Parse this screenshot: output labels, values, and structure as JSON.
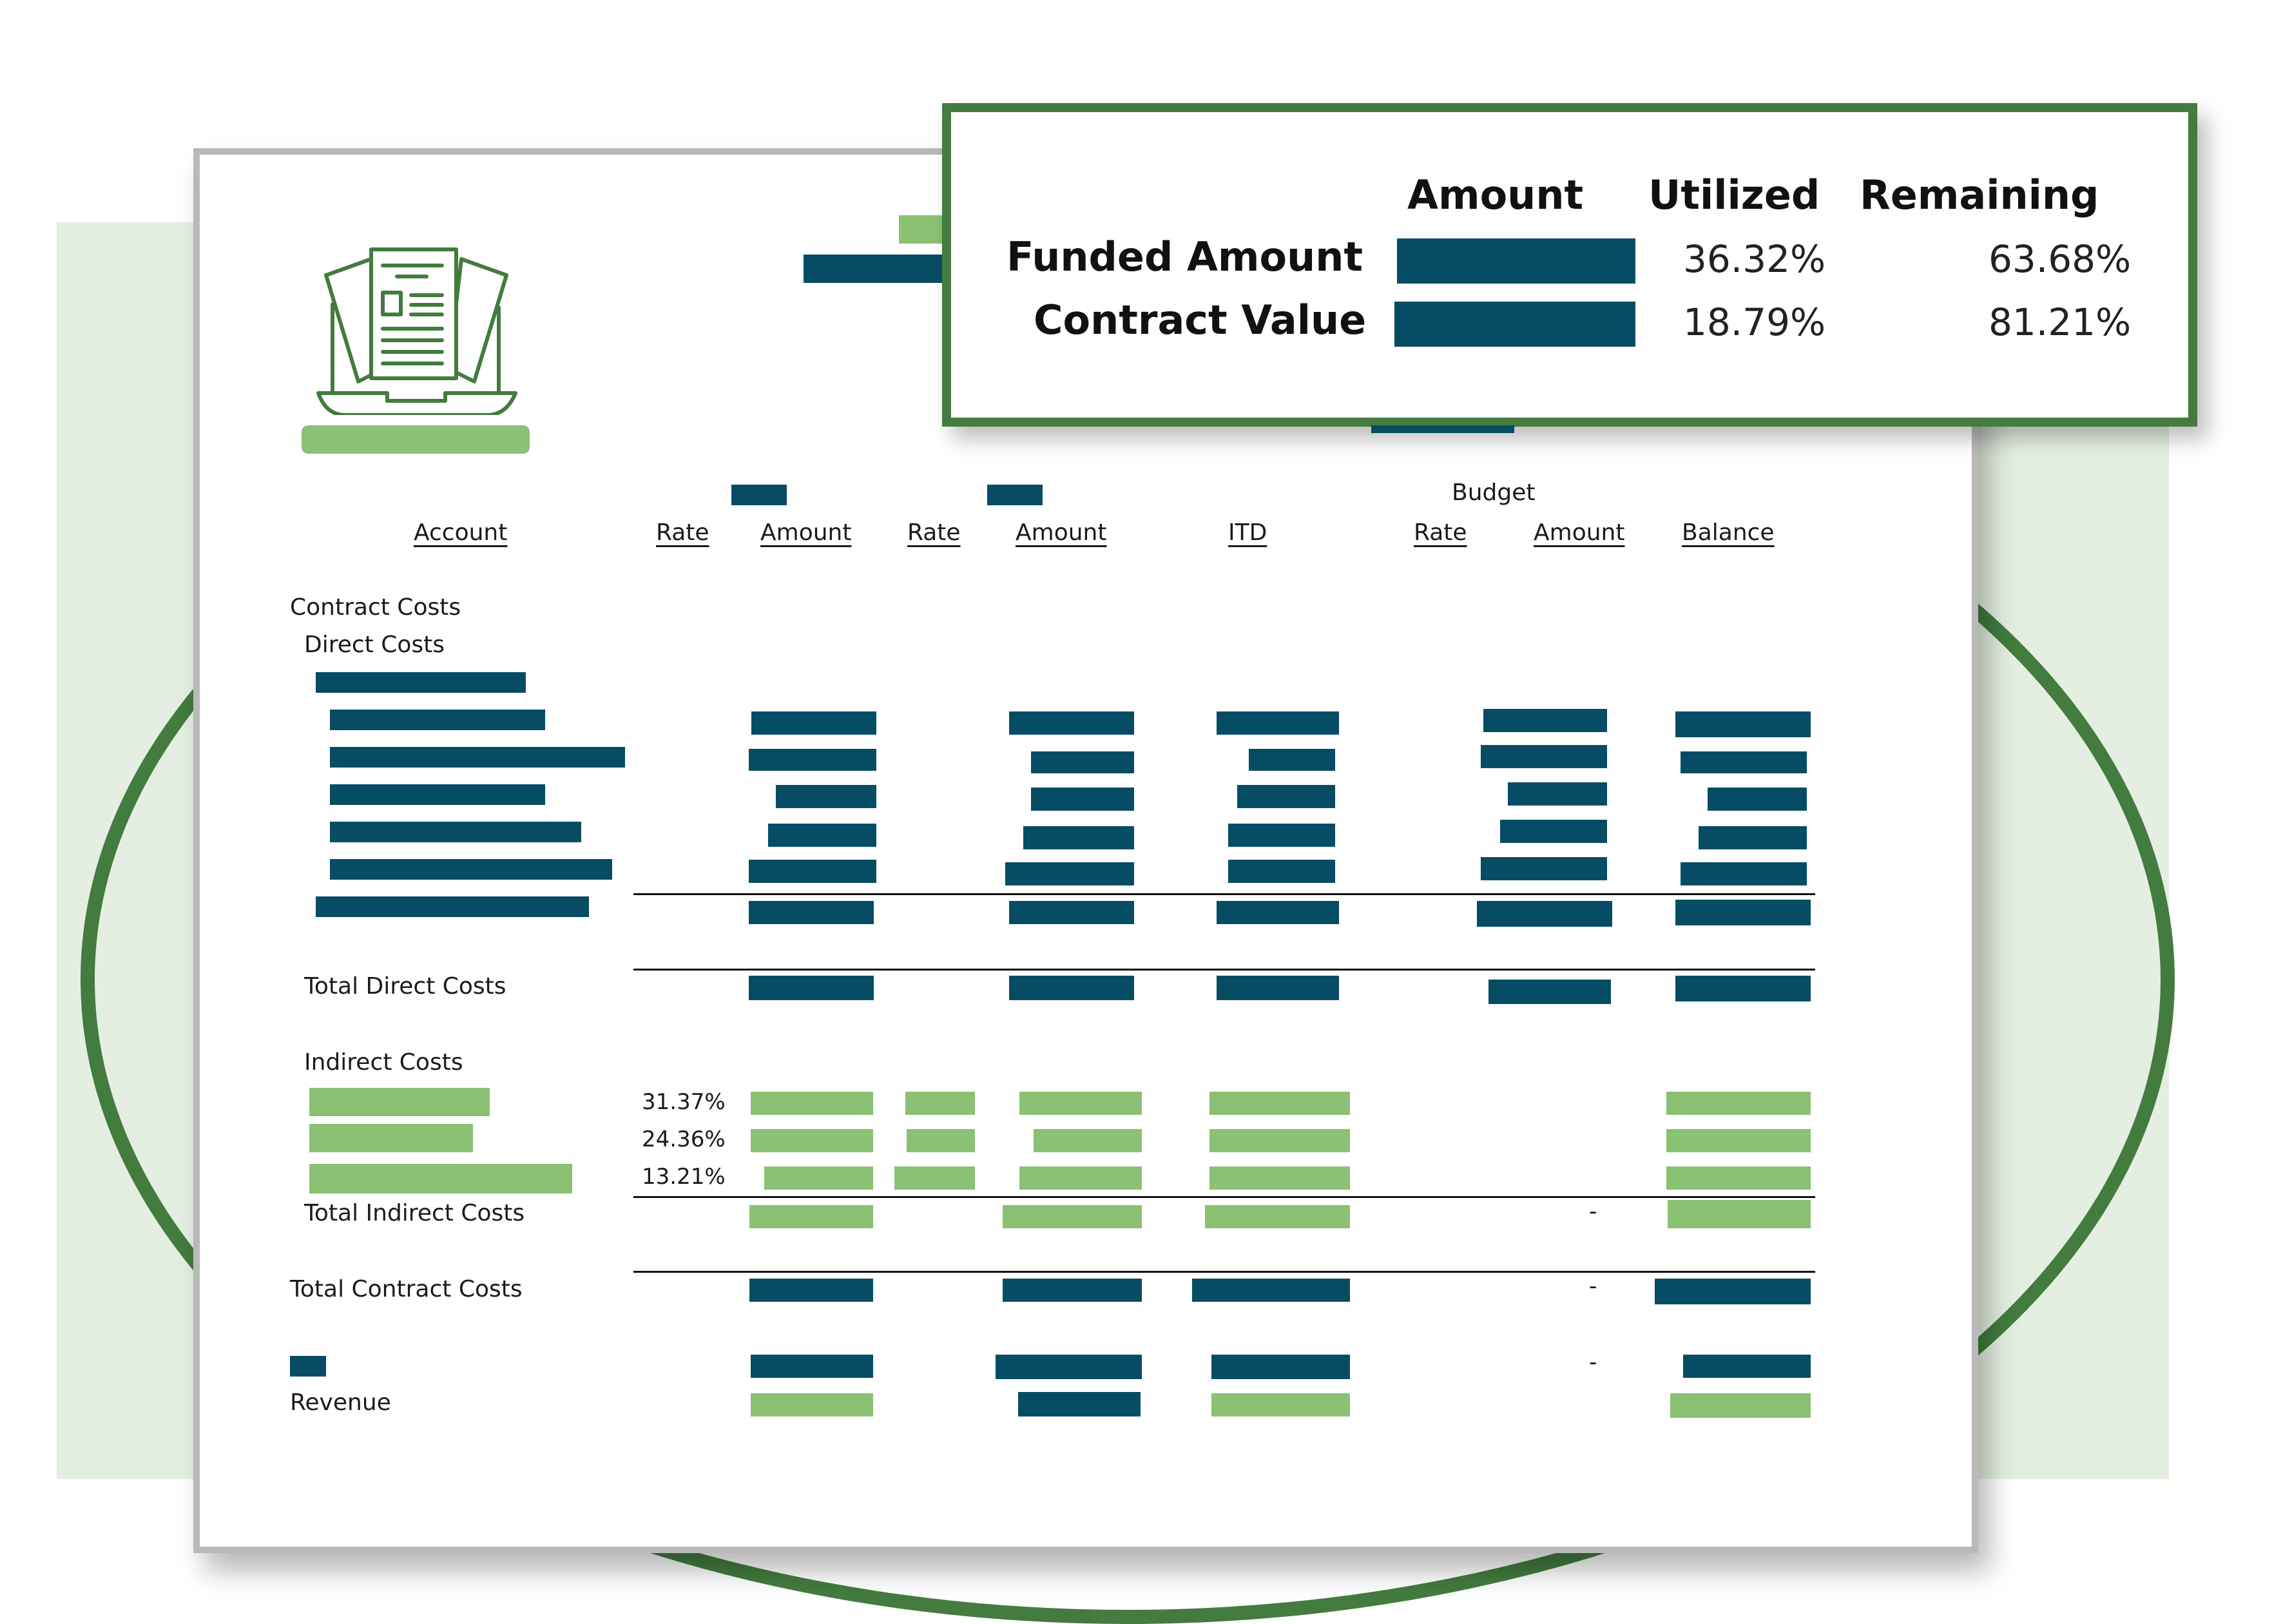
{
  "colors": {
    "brand_green": "#437c3e",
    "light_green": "#8bc172",
    "dark_teal": "#074c65",
    "background_tint": "#e4efe1"
  },
  "logo": {
    "icon": "laptop-documents-icon"
  },
  "summary_card": {
    "headers": [
      "Amount",
      "Utilized",
      "Remaining"
    ],
    "rows": [
      {
        "label": "Funded Amount",
        "utilized": "36.32%",
        "remaining": "63.68%"
      },
      {
        "label": "Contract Value",
        "utilized": "18.79%",
        "remaining": "81.21%"
      }
    ]
  },
  "table": {
    "group_header": "Budget",
    "columns": [
      "Account",
      "Rate",
      "Amount",
      "Rate",
      "Amount",
      "ITD",
      "Rate",
      "Amount",
      "Balance"
    ],
    "sections": {
      "contract_costs": "Contract Costs",
      "direct_costs": "Direct Costs",
      "total_direct_costs": "Total Direct Costs",
      "indirect_costs": "Indirect Costs",
      "total_indirect_costs": "Total Indirect Costs",
      "total_contract_costs": "Total Contract Costs",
      "revenue": "Revenue"
    },
    "indirect_rates": [
      "31.37%",
      "24.36%",
      "13.21%"
    ],
    "empty_value": "-"
  }
}
